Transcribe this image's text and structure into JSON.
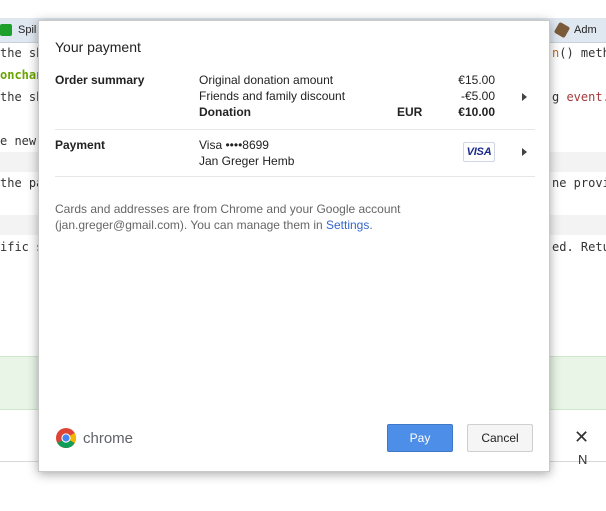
{
  "background": {
    "tabs": [
      {
        "label": "Spil"
      },
      {
        "label": "Adm"
      }
    ],
    "lines": [
      {
        "text": "the sh"
      },
      {
        "text": "onchan"
      },
      {
        "text": "the sh"
      },
      {
        "text": "e new"
      },
      {
        "text": "the pa"
      },
      {
        "text": "ific ste"
      }
    ],
    "right_fragments": {
      "method_fn": "n",
      "method_tail": "() metho",
      "event_prefix": "g ",
      "event_code": "event.u",
      "provide": "ne provide",
      "return": "ed. Retur"
    },
    "close_label": "N"
  },
  "dialog": {
    "title": "Your payment",
    "order_summary": {
      "label": "Order summary",
      "items": [
        {
          "name": "Original donation amount",
          "currency": "",
          "amount": "€15.00"
        },
        {
          "name": "Friends and family discount",
          "currency": "",
          "amount": "-€5.00"
        },
        {
          "name": "Donation",
          "currency": "EUR",
          "amount": "€10.00"
        }
      ]
    },
    "payment": {
      "label": "Payment",
      "card": "Visa  ••••8699",
      "holder": "Jan Greger Hemb",
      "card_logo": "VISA"
    },
    "footnote": "Cards and addresses are from Chrome and your Google account (jan.greger@gmail.com). You can manage them in",
    "footnote_link": "Settings",
    "footnote_end": ".",
    "brand": "chrome",
    "pay_label": "Pay",
    "cancel_label": "Cancel",
    "colors": {
      "accent": "#4d8ee8",
      "link": "#3366cc"
    }
  }
}
